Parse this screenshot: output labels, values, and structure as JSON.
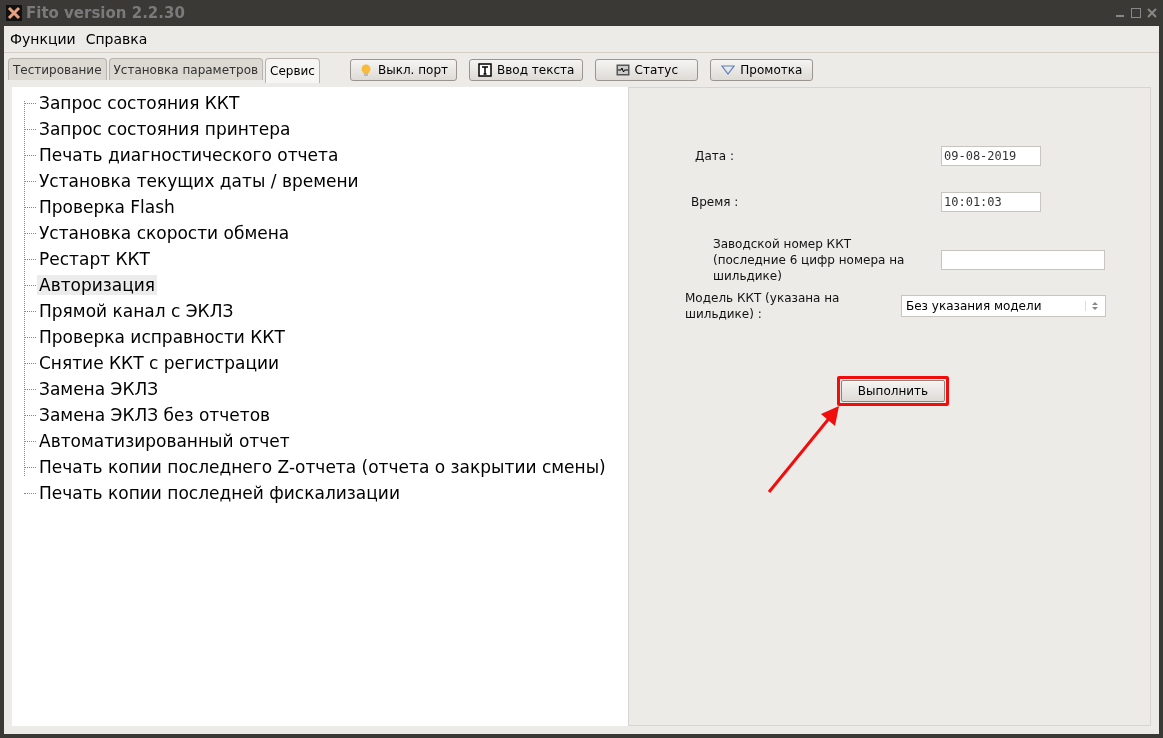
{
  "window": {
    "title": "Fito version 2.2.30"
  },
  "menu": [
    "Функции",
    "Справка"
  ],
  "tabs": [
    {
      "label": "Тестирование",
      "selected": false
    },
    {
      "label": "Установка параметров",
      "selected": false
    },
    {
      "label": "Сервис",
      "selected": true
    }
  ],
  "toolbar": [
    {
      "label": "Выкл. порт",
      "kind": "bulb"
    },
    {
      "label": "Ввод текста",
      "kind": "text"
    },
    {
      "label": "Статус",
      "kind": "monitor"
    },
    {
      "label": "Промотка",
      "kind": "triangle"
    }
  ],
  "tree": [
    {
      "label": "Запрос состояния ККТ",
      "selected": false
    },
    {
      "label": "Запрос состояния принтера",
      "selected": false
    },
    {
      "label": "Печать диагностического отчета",
      "selected": false
    },
    {
      "label": "Установка текущих даты / времени",
      "selected": false
    },
    {
      "label": "Проверка Flash",
      "selected": false
    },
    {
      "label": "Установка скорости обмена",
      "selected": false
    },
    {
      "label": "Рестарт ККТ",
      "selected": false
    },
    {
      "label": "Авторизация",
      "selected": true
    },
    {
      "label": "Прямой канал с ЭКЛЗ",
      "selected": false
    },
    {
      "label": "Проверка исправности ККТ",
      "selected": false
    },
    {
      "label": "Снятие ККТ с регистрации",
      "selected": false
    },
    {
      "label": "Замена ЭКЛЗ",
      "selected": false
    },
    {
      "label": "Замена ЭКЛЗ без отчетов",
      "selected": false
    },
    {
      "label": "Автоматизированный отчет",
      "selected": false
    },
    {
      "label": "Печать копии последнего Z-отчета (отчета о закрытии смены)",
      "selected": false
    },
    {
      "label": "Печать копии последней фискализации",
      "selected": false
    }
  ],
  "form": [
    {
      "kind": "text",
      "label": "Дата :",
      "value": "09-08-2019"
    },
    {
      "kind": "text",
      "label": "Время :",
      "value": "10:01:03"
    },
    {
      "kind": "wide",
      "label": "Заводской номер ККТ (последние 6 цифр номера на шильдике)"
    },
    {
      "kind": "select",
      "label": "Модель ККТ (указана на шильдике)  :",
      "value": "Без указания модели"
    }
  ],
  "execute_button": {
    "label": "Выполнить",
    "highlighted": true
  }
}
